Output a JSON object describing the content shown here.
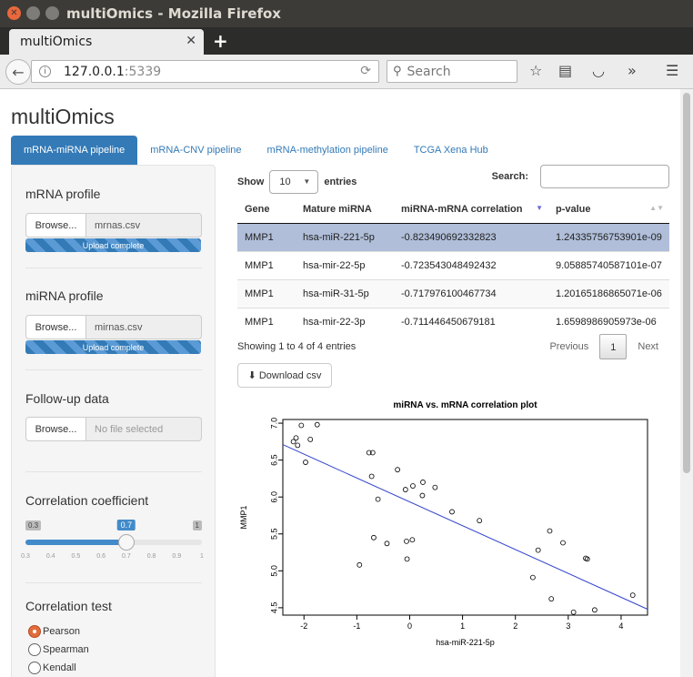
{
  "window": {
    "title": "multiOmics - Mozilla Firefox"
  },
  "browser": {
    "tab_label": "multiOmics",
    "url_host": "127.0.0.1",
    "url_port": ":5339",
    "search_placeholder": "Search"
  },
  "app": {
    "title": "multiOmics",
    "tabs": [
      "mRNA-miRNA pipeline",
      "mRNA-CNV pipeline",
      "mRNA-methylation pipeline",
      "TCGA Xena Hub"
    ]
  },
  "sidebar": {
    "mrna_label": "mRNA profile",
    "mirna_label": "miRNA profile",
    "followup_label": "Follow-up data",
    "browse_label": "Browse...",
    "mrna_file": "mrnas.csv",
    "mirna_file": "mirnas.csv",
    "followup_file": "No file selected",
    "upload_status": "Upload complete",
    "corr_label": "Correlation coefficient",
    "slider_min": "0.3",
    "slider_max": "1",
    "slider_value": 0.7,
    "slider_value_label": "0.7",
    "slider_ticks": [
      "0.3",
      "0.4",
      "0.5",
      "0.6",
      "0.7",
      "0.8",
      "0.9",
      "1"
    ],
    "test_label": "Correlation test",
    "tests": [
      "Pearson",
      "Spearman",
      "Kendall"
    ],
    "selected_test": "Pearson"
  },
  "table": {
    "show_label": "Show",
    "entries_value": "10",
    "entries_label": "entries",
    "search_label": "Search:",
    "columns": [
      "Gene",
      "Mature miRNA",
      "miRNA-mRNA correlation",
      "p-value"
    ],
    "rows": [
      [
        "MMP1",
        "hsa-miR-221-5p",
        "-0.823490692332823",
        "1.24335756753901e-09"
      ],
      [
        "MMP1",
        "hsa-mir-22-5p",
        "-0.723543048492432",
        "9.05885740587101e-07"
      ],
      [
        "MMP1",
        "hsa-miR-31-5p",
        "-0.717976100467734",
        "1.20165186865071e-06"
      ],
      [
        "MMP1",
        "hsa-mir-22-3p",
        "-0.711446450679181",
        "1.6598986905973e-06"
      ]
    ],
    "info": "Showing 1 to 4 of 4 entries",
    "prev": "Previous",
    "page": "1",
    "next": "Next",
    "download_label": "Download csv"
  },
  "chart_data": {
    "type": "scatter",
    "title": "miRNA vs. mRNA correlation plot",
    "xlabel": "hsa-miR-221-5p",
    "ylabel": "MMP1",
    "xlim": [
      -2.4,
      4.5
    ],
    "ylim": [
      4.4,
      7.05
    ],
    "xticks": [
      -2,
      -1,
      0,
      1,
      2,
      3,
      4
    ],
    "yticks": [
      4.5,
      5.0,
      5.5,
      6.0,
      6.5,
      7.0
    ],
    "ytick_labels": [
      "4.5",
      "5.0",
      "5.5",
      "6.0",
      "6.5",
      "7.0"
    ],
    "points": [
      [
        -2.2,
        6.75
      ],
      [
        -2.15,
        6.8
      ],
      [
        -2.12,
        6.7
      ],
      [
        -2.05,
        6.97
      ],
      [
        -1.97,
        6.47
      ],
      [
        -1.88,
        6.78
      ],
      [
        -1.75,
        6.98
      ],
      [
        -0.77,
        6.6
      ],
      [
        -0.7,
        6.6
      ],
      [
        -0.72,
        6.28
      ],
      [
        -0.68,
        5.45
      ],
      [
        -0.6,
        5.97
      ],
      [
        -0.95,
        5.08
      ],
      [
        -0.43,
        5.37
      ],
      [
        -0.23,
        6.37
      ],
      [
        -0.08,
        6.1
      ],
      [
        0.06,
        6.15
      ],
      [
        -0.06,
        5.4
      ],
      [
        0.05,
        5.42
      ],
      [
        -0.05,
        5.16
      ],
      [
        0.25,
        6.2
      ],
      [
        0.24,
        6.02
      ],
      [
        0.48,
        6.13
      ],
      [
        0.8,
        5.8
      ],
      [
        1.32,
        5.68
      ],
      [
        2.33,
        4.91
      ],
      [
        2.43,
        5.28
      ],
      [
        2.65,
        5.54
      ],
      [
        2.9,
        5.38
      ],
      [
        2.68,
        4.62
      ],
      [
        3.1,
        4.44
      ],
      [
        3.33,
        5.17
      ],
      [
        3.36,
        5.16
      ],
      [
        3.5,
        4.47
      ],
      [
        4.22,
        4.67
      ]
    ],
    "regression_line": {
      "x": [
        -2.4,
        4.5
      ],
      "y": [
        6.71,
        4.48
      ]
    },
    "line_color": "#3344cc"
  }
}
